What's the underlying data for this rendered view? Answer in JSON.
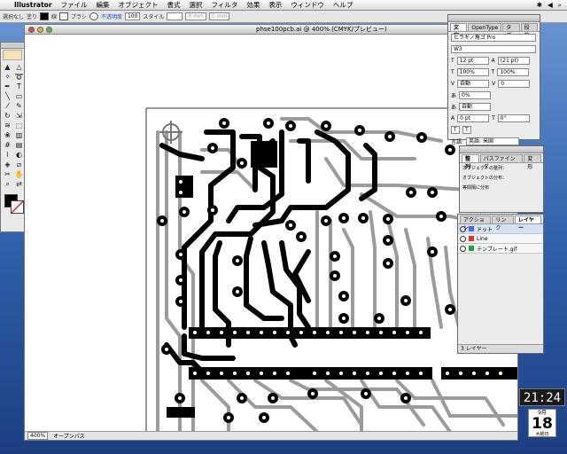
{
  "menubar": {
    "app_name": "Illustrator",
    "items": [
      "ファイル",
      "編集",
      "オブジェクト",
      "書式",
      "選択",
      "フィルタ",
      "効果",
      "表示",
      "ウィンドウ",
      "ヘルプ"
    ]
  },
  "control_bar": {
    "selection_label": "選択なし",
    "fill_label": "塗り",
    "stroke_label": "線",
    "brush_label": "ブラシ",
    "opacity_label": "不透明度",
    "opacity_value": "100",
    "style_label": "スタイル",
    "width_value": "0 mm",
    "height_value": "0 mm"
  },
  "document": {
    "title": "phse100pcb.ai @ 400% (CMYK/プレビュー)",
    "zoom": "400%",
    "status": "オープンパス"
  },
  "character_panel": {
    "tabs": [
      "文字",
      "OpenType",
      "タブ",
      "段落"
    ],
    "font": "ヒラギノ角ゴ Pro",
    "weight": "W3",
    "size": "12 pt",
    "leading": "(21 pt)",
    "h_scale": "100%",
    "v_scale": "100%",
    "tracking": "0",
    "kerning": "自動",
    "tsume": "0%",
    "mojikumi": "自動",
    "baseline": "0 pt",
    "rotation": "0°",
    "language": "英語: 米国"
  },
  "align_panel": {
    "tabs": [
      "整列",
      "パスファインダ",
      "変形"
    ],
    "label_objects": "オブジェクトの整列：",
    "label_distribute": "オブジェクトの分布：",
    "label_spacing": "等間隔に分布"
  },
  "layers_panel": {
    "tabs": [
      "アクション",
      "リンク",
      "レイヤー"
    ],
    "layers": [
      {
        "name": "ドット",
        "color": "#3b6cff"
      },
      {
        "name": "Line",
        "color": "#e03030"
      },
      {
        "name": "テンプレート.gif",
        "color": "#20a040"
      }
    ],
    "footer": "3 レイヤー"
  },
  "clock": {
    "time": "21:24",
    "month": "9月",
    "day": "18",
    "weekday": "木曜日"
  }
}
